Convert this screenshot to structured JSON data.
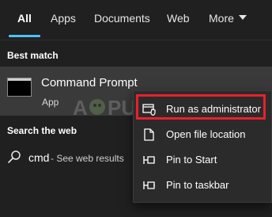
{
  "tabs": [
    {
      "label": "All",
      "active": true
    },
    {
      "label": "Apps"
    },
    {
      "label": "Documents"
    },
    {
      "label": "Web"
    },
    {
      "label": "More"
    }
  ],
  "best_match": {
    "heading": "Best match",
    "title": "Command Prompt",
    "subtitle": "App",
    "icon": "command-prompt-icon"
  },
  "search_web": {
    "heading": "Search the web",
    "query": "cmd",
    "hint": "- See web results",
    "icon": "search-icon"
  },
  "context_menu": {
    "items": [
      {
        "label": "Run as administrator",
        "icon": "shield-admin-icon",
        "highlighted": true
      },
      {
        "label": "Open file location",
        "icon": "file-location-icon"
      },
      {
        "label": "Pin to Start",
        "icon": "pin-icon"
      },
      {
        "label": "Pin to taskbar",
        "icon": "pin-icon"
      }
    ]
  },
  "watermark": {
    "text": "APPUALS"
  },
  "colors": {
    "background": "#202020",
    "selected_row": "#3a3a3a",
    "menu_background": "#2b2b2b",
    "accent": "#4cc2ff",
    "highlight_border": "#e8212c"
  }
}
